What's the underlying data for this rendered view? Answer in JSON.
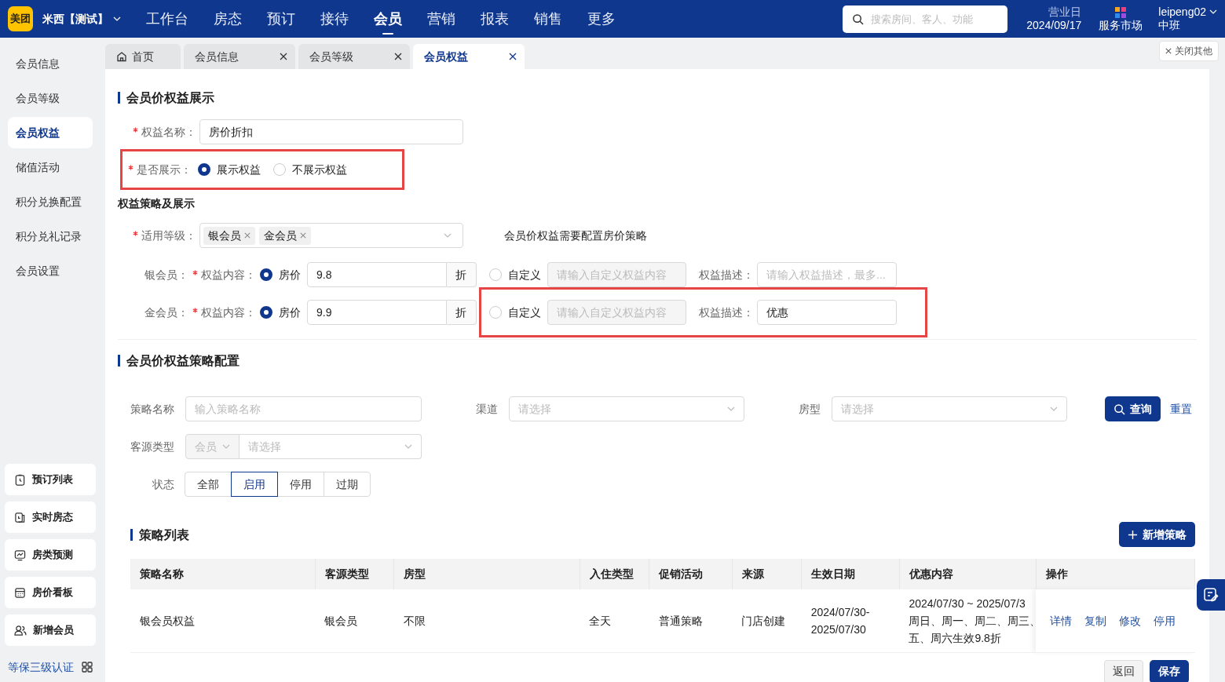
{
  "topbar": {
    "logo": "美团",
    "hotel": "米西【测试】",
    "nav": [
      {
        "label": "工作台",
        "selected": false
      },
      {
        "label": "房态",
        "selected": false
      },
      {
        "label": "预订",
        "selected": false
      },
      {
        "label": "接待",
        "selected": false
      },
      {
        "label": "会员",
        "selected": true
      },
      {
        "label": "营销",
        "selected": false
      },
      {
        "label": "报表",
        "selected": false
      },
      {
        "label": "销售",
        "selected": false
      },
      {
        "label": "更多",
        "selected": false
      }
    ],
    "search": {
      "placeholder": "搜索房间、客人、功能"
    },
    "business_day_label": "营业日",
    "business_day": "2024/09/17",
    "market": "服务市场",
    "user": "leipeng02",
    "shift": "中班"
  },
  "sidebar": {
    "items": [
      {
        "label": "会员信息",
        "selected": false
      },
      {
        "label": "会员等级",
        "selected": false
      },
      {
        "label": "会员权益",
        "selected": true
      },
      {
        "label": "储值活动",
        "selected": false
      },
      {
        "label": "积分兑换配置",
        "selected": false
      },
      {
        "label": "积分兑礼记录",
        "selected": false
      },
      {
        "label": "会员设置",
        "selected": false
      }
    ],
    "shortcuts": [
      {
        "label": "预订列表"
      },
      {
        "label": "实时房态"
      },
      {
        "label": "房类预测"
      },
      {
        "label": "房价看板"
      },
      {
        "label": "新增会员"
      }
    ],
    "certification": "等保三级认证"
  },
  "tabs": [
    {
      "label": "首页",
      "selected": false,
      "closable": false
    },
    {
      "label": "会员信息",
      "selected": false,
      "closable": true
    },
    {
      "label": "会员等级",
      "selected": false,
      "closable": true
    },
    {
      "label": "会员权益",
      "selected": true,
      "closable": true
    }
  ],
  "close_others": "关闭其他",
  "benefit_display": {
    "title": "会员价权益展示",
    "name_field": {
      "label": "权益名称：",
      "required": true,
      "value": "房价折扣"
    },
    "display_field": {
      "label": "是否展示：",
      "required": true,
      "highlighted": true,
      "options": [
        {
          "label": "展示权益",
          "selected": true
        },
        {
          "label": "不展示权益",
          "selected": false
        }
      ]
    },
    "subtitle": "权益策略及展示",
    "levels_field": {
      "label": "适用等级：",
      "required": true,
      "tags": [
        "银会员",
        "金会员"
      ],
      "note": "会员价权益需要配置房价策略"
    },
    "tiers": [
      {
        "name": "银会员：",
        "content_label": "权益内容：",
        "required": true,
        "price": {
          "label": "房价",
          "selected": true
        },
        "value": "9.8",
        "unit": "折",
        "custom": {
          "label": "自定义",
          "selected": false,
          "placeholder": "请输入自定义权益内容"
        },
        "desc_label": "权益描述：",
        "desc_placeholder": "请输入权益描述，最多...",
        "highlighted": false
      },
      {
        "name": "金会员：",
        "content_label": "权益内容：",
        "required": true,
        "price": {
          "label": "房价",
          "selected": true
        },
        "value": "9.9",
        "unit": "折",
        "custom": {
          "label": "自定义",
          "selected": false,
          "placeholder": "请输入自定义权益内容"
        },
        "desc_label": "权益描述：",
        "desc_value": "优惠",
        "highlighted": true
      }
    ]
  },
  "strategy_config": {
    "title": "会员价权益策略配置",
    "filters": {
      "name": {
        "label": "策略名称",
        "placeholder": "输入策略名称"
      },
      "channel": {
        "label": "渠道",
        "placeholder": "请选择"
      },
      "room_type": {
        "label": "房型",
        "placeholder": "请选择"
      },
      "source": {
        "label": "客源类型",
        "prefix": "会员",
        "placeholder": "请选择"
      },
      "status": {
        "label": "状态",
        "options": [
          {
            "label": "全部",
            "selected": false
          },
          {
            "label": "启用",
            "selected": true
          },
          {
            "label": "停用",
            "selected": false
          },
          {
            "label": "过期",
            "selected": false
          }
        ]
      },
      "query": "查询",
      "reset": "重置"
    }
  },
  "strategy_list": {
    "title": "策略列表",
    "add_button": "新增策略",
    "table": {
      "columns": [
        "策略名称",
        "客源类型",
        "房型",
        "入住类型",
        "促销活动",
        "来源",
        "生效日期",
        "优惠内容",
        "操作"
      ],
      "rows": [
        {
          "cells": [
            "银会员权益",
            "银会员",
            "不限",
            "全天",
            "普通策略",
            "门店创建"
          ],
          "date_lines": [
            "2024/07/30-",
            "2025/07/30"
          ],
          "offer_lines": [
            "2024/07/30 ~ 2025/07/3",
            "周日、周一、周二、周三、",
            "五、周六生效9.8折"
          ],
          "actions": [
            "详情",
            "复制",
            "修改",
            "停用"
          ]
        }
      ]
    }
  },
  "footer_buttons": [
    {
      "label": "返回",
      "kind": "secondary"
    },
    {
      "label": "保存",
      "kind": "primary"
    }
  ]
}
